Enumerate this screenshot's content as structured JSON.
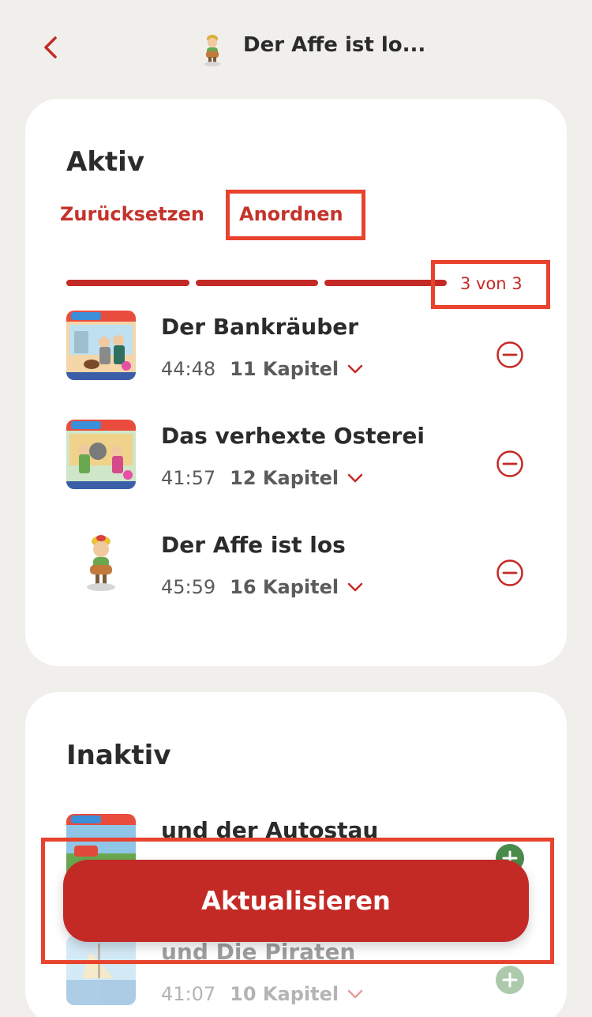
{
  "header": {
    "title": "Der Affe ist lo...",
    "back_icon": "chevron-left-icon",
    "figure_icon": "character-figure-icon"
  },
  "active": {
    "title": "Aktiv",
    "reset_label": "Zurücksetzen",
    "arrange_label": "Anordnen",
    "progress": {
      "current": 3,
      "total": 3,
      "label": "3 von 3"
    },
    "tracks": [
      {
        "title": "Der Bankräuber",
        "duration": "44:48",
        "chapters": "11 Kapitel",
        "action_icon": "minus-circle-icon"
      },
      {
        "title": "Das verhexte Osterei",
        "duration": "41:57",
        "chapters": "12 Kapitel",
        "action_icon": "minus-circle-icon"
      },
      {
        "title": "Der Affe ist los",
        "duration": "45:59",
        "chapters": "16 Kapitel",
        "action_icon": "minus-circle-icon"
      }
    ]
  },
  "inactive": {
    "title": "Inaktiv",
    "tracks": [
      {
        "title": "und der Autostau",
        "duration": "",
        "chapters": "",
        "action_icon": "plus-circle-icon"
      },
      {
        "title": "und Die Piraten",
        "duration": "41:07",
        "chapters": "10 Kapitel",
        "action_icon": "plus-circle-icon"
      }
    ]
  },
  "footer": {
    "update_label": "Aktualisieren"
  },
  "colors": {
    "accent": "#c42a25",
    "highlight": "#e8432e",
    "background": "#f1efec",
    "add_green": "#4a8a4a"
  }
}
